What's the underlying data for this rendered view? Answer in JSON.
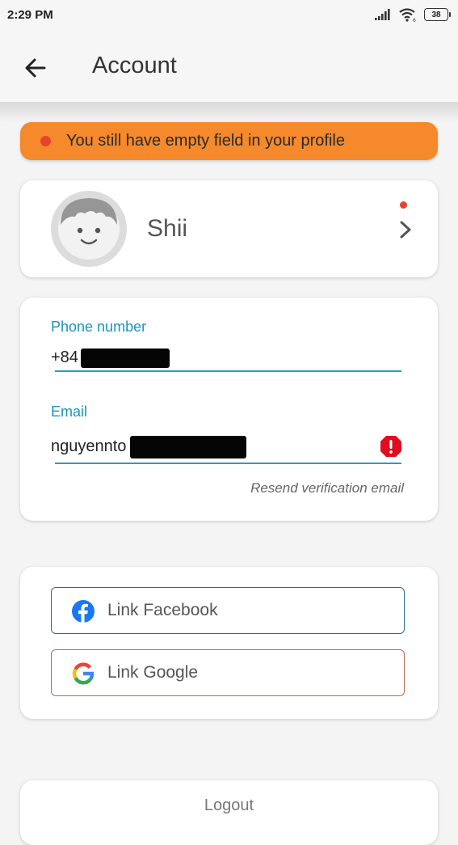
{
  "status_bar": {
    "time": "2:29 PM",
    "battery": "38"
  },
  "app_bar": {
    "title": "Account"
  },
  "alert": {
    "message": "You still have empty field in your profile"
  },
  "profile": {
    "name": "Shii"
  },
  "contact": {
    "phone_label": "Phone number",
    "phone_value": "+84",
    "email_label": "Email",
    "email_value": "nguyennto",
    "resend_label": "Resend verification email"
  },
  "social": {
    "facebook_label": "Link Facebook",
    "google_label": "Link Google"
  },
  "logout_label": "Logout",
  "colors": {
    "accent": "#1c93bb",
    "alert_bg": "#f5892c",
    "error": "#e00d1e",
    "facebook": "#1877f2"
  }
}
